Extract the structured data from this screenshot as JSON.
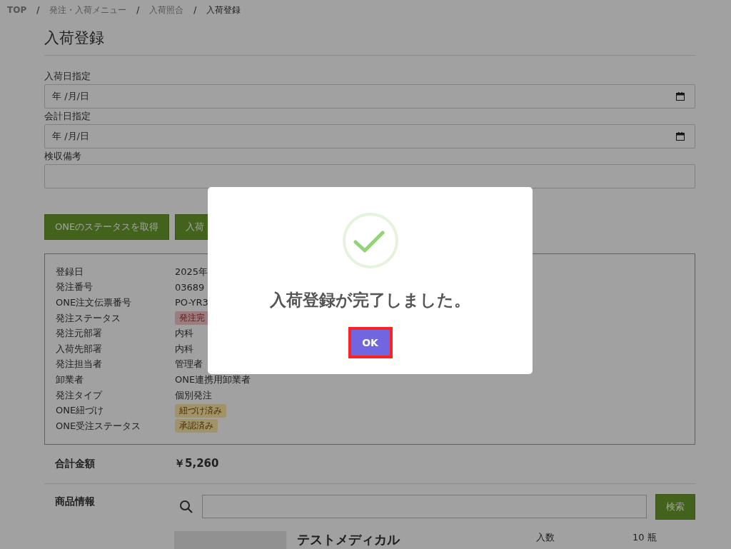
{
  "breadcrumb": [
    {
      "label": "TOP",
      "current": false
    },
    {
      "label": "発注・入荷メニュー",
      "current": false
    },
    {
      "label": "入荷照合",
      "current": false
    },
    {
      "label": "入荷登録",
      "current": true
    }
  ],
  "breadcrumb_separator": "/",
  "page_title": "入荷登録",
  "form_fields": [
    {
      "kind": "date",
      "label": "入荷日指定",
      "placeholder": "年 /月/日"
    },
    {
      "kind": "date",
      "label": "会計日指定",
      "placeholder": "年 /月/日"
    },
    {
      "kind": "text",
      "label": "検収備考"
    }
  ],
  "action_buttons": [
    "ONEのステータスを取得",
    "入荷"
  ],
  "details": [
    {
      "label": "登録日",
      "value": "2025年",
      "kind": "text"
    },
    {
      "label": "発注番号",
      "value": "03689",
      "kind": "text"
    },
    {
      "label": "ONE注文伝票番号",
      "value": "PO-YR3",
      "kind": "text"
    },
    {
      "label": "発注ステータス",
      "value": "発注完",
      "kind": "alert"
    },
    {
      "label": "発注元部署",
      "value": "内科",
      "kind": "text"
    },
    {
      "label": "入荷先部署",
      "value": "内科",
      "kind": "text"
    },
    {
      "label": "発注担当者",
      "value": "管理者",
      "kind": "text"
    },
    {
      "label": "卸業者",
      "value": "ONE連携用卸業者",
      "kind": "text"
    },
    {
      "label": "発注タイプ",
      "value": "個別発注",
      "kind": "text"
    },
    {
      "label": "ONE紐づけ",
      "value": "紐づけ済み",
      "kind": "notice"
    },
    {
      "label": "ONE受注ステータス",
      "value": "承認済み",
      "kind": "notice"
    }
  ],
  "total": {
    "label": "合計金額",
    "value": "￥5,260"
  },
  "products": {
    "label": "商品情報",
    "search_button": "検索",
    "item": {
      "name": "テストメディカル",
      "specs": [
        {
          "label": "入数",
          "value": "10 瓶"
        }
      ]
    }
  },
  "dialog": {
    "message": "入荷登録が完了しました。",
    "confirm_button": "OK",
    "focused": true
  }
}
